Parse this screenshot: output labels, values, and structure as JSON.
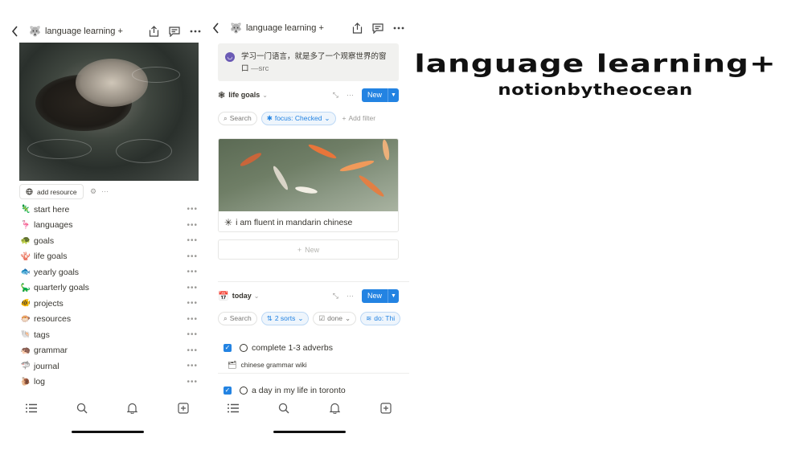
{
  "left_phone": {
    "breadcrumb": {
      "icon": "🐺",
      "title": "language learning +"
    },
    "add_resource_label": "add resource",
    "nav_items": [
      {
        "emoji": "🦎",
        "label": "start here"
      },
      {
        "emoji": "🦩",
        "label": "languages"
      },
      {
        "emoji": "🐢",
        "label": "goals"
      },
      {
        "emoji": "🪸",
        "label": "life goals"
      },
      {
        "emoji": "🐟",
        "label": "yearly goals"
      },
      {
        "emoji": "🦕",
        "label": "quarterly goals"
      },
      {
        "emoji": "🐠",
        "label": "projects"
      },
      {
        "emoji": "🐡",
        "label": "resources"
      },
      {
        "emoji": "🐚",
        "label": "tags"
      },
      {
        "emoji": "🦔",
        "label": "grammar"
      },
      {
        "emoji": "🦈",
        "label": "journal"
      },
      {
        "emoji": "🐌",
        "label": "log"
      }
    ],
    "more_glyph": "•••"
  },
  "right_phone": {
    "breadcrumb": {
      "icon": "🐺",
      "title": "language learning +"
    },
    "callout": {
      "text": "学习一门语言，就是多了一个观察世界的窗口",
      "source": "—src"
    },
    "life_goals": {
      "title": "life goals",
      "new_label": "New",
      "search_label": "Search",
      "filter_label": "focus: Checked",
      "add_filter_label": "Add filter",
      "card_title": "i am fluent in mandarin chinese",
      "new_row_label": "New"
    },
    "today": {
      "title": "today",
      "new_label": "New",
      "search_label": "Search",
      "sorts_label": "2 sorts",
      "done_label": "done",
      "do_label": "do: Thi",
      "tasks": [
        {
          "title": "complete 1-3 adverbs",
          "relation": "chinese grammar wiki"
        },
        {
          "title": "a day in my life in toronto"
        }
      ]
    }
  },
  "title_art": {
    "title": "language learning+",
    "subtitle": "notionbytheocean"
  }
}
